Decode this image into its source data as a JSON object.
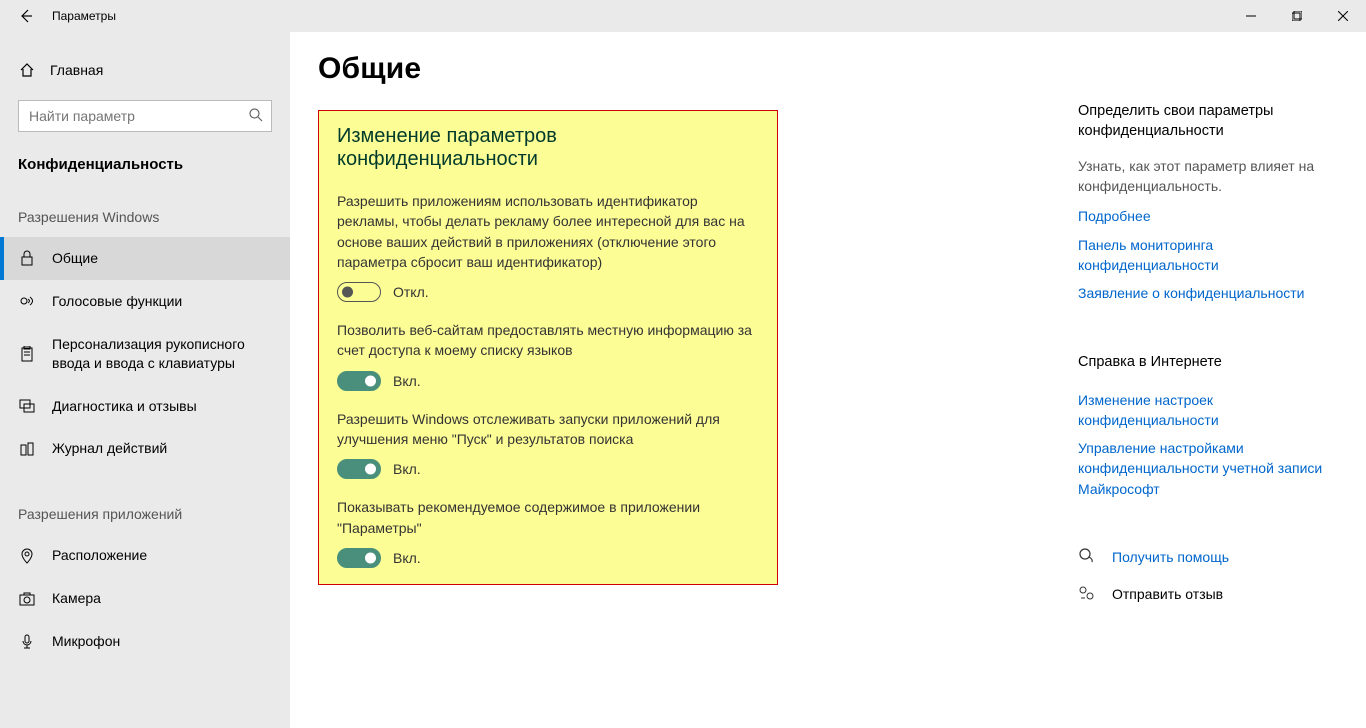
{
  "window": {
    "title": "Параметры"
  },
  "sidebar": {
    "home": "Главная",
    "search_placeholder": "Найти параметр",
    "category": "Конфиденциальность",
    "group1": "Разрешения Windows",
    "group2": "Разрешения приложений",
    "items1": [
      "Общие",
      "Голосовые функции",
      "Персонализация рукописного ввода и ввода с клавиатуры",
      "Диагностика и отзывы",
      "Журнал действий"
    ],
    "items2": [
      "Расположение",
      "Камера",
      "Микрофон"
    ]
  },
  "main": {
    "heading": "Общие",
    "section_title": "Изменение параметров конфиденциальности",
    "on_label": "Вкл.",
    "off_label": "Откл.",
    "settings": [
      "Разрешить приложениям использовать идентификатор рекламы, чтобы делать рекламу более интересной для вас на основе ваших действий в приложениях (отключение этого параметра сбросит ваш идентификатор)",
      "Позволить веб-сайтам предоставлять местную информацию за счет доступа к моему списку языков",
      "Разрешить Windows отслеживать запуски приложений для улучшения меню \"Пуск\" и результатов поиска",
      "Показывать рекомендуемое содержимое в приложении \"Параметры\""
    ]
  },
  "right": {
    "title1": "Определить свои параметры конфиденциальности",
    "desc1": "Узнать, как этот параметр влияет на конфиденциальность.",
    "links1": [
      "Подробнее",
      "Панель мониторинга конфиденциальности",
      "Заявление о конфиденциальности"
    ],
    "help_title": "Справка в Интернете",
    "links2": [
      "Изменение настроек конфиденциальности",
      "Управление настройками конфиденциальности учетной записи Майкрософт"
    ],
    "get_help": "Получить помощь",
    "feedback": "Отправить отзыв"
  }
}
